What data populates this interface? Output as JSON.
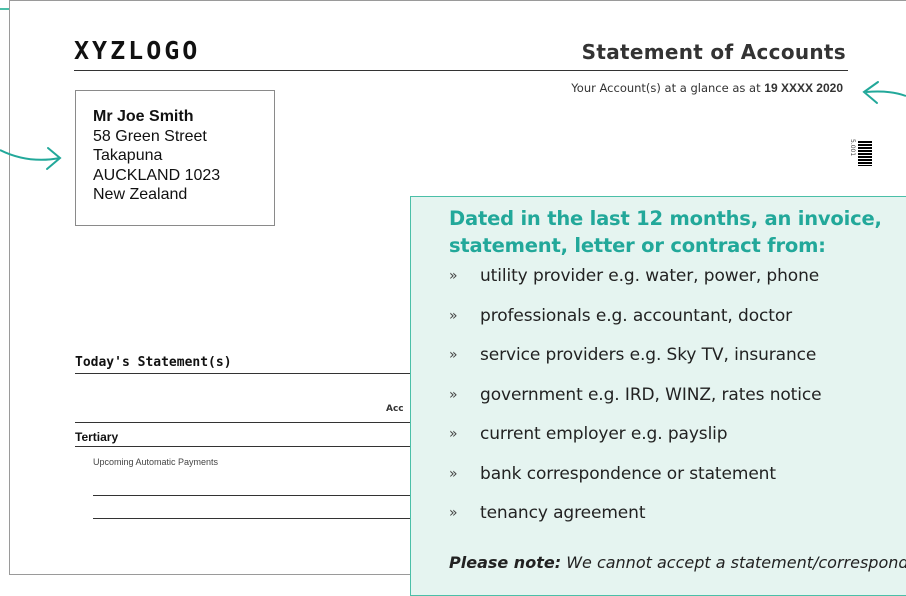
{
  "document": {
    "logo": "XYZLOGO",
    "title": "Statement of Accounts",
    "glance_prefix": "Your Account(s) at a glance as at",
    "glance_date": "19 XXXX 2020",
    "barcode_text": "5.001",
    "address": {
      "name": "Mr Joe Smith",
      "line1": "58 Green Street",
      "line2": "Takapuna",
      "line3": "AUCKLAND 1023",
      "line4": "New Zealand"
    },
    "today_statement": "Today's Statement(s)",
    "account_header": "Acc",
    "tertiary": "Tertiary",
    "upcoming": "Upcoming Automatic Payments"
  },
  "info": {
    "heading_line1": "Dated in the last 12 months, an invoice,",
    "heading_line2": "statement, letter or contract from:",
    "bullet_glyph": "»",
    "items": [
      "utility provider e.g. water, power, phone",
      "professionals e.g. accountant, doctor",
      "service providers e.g. Sky TV, insurance",
      "government e.g. IRD, WINZ, rates notice",
      "current employer e.g. payslip",
      "bank correspondence or statement",
      "tenancy agreement"
    ],
    "note_label": "Please note:",
    "note_text": "We cannot accept a statement/correspondence"
  },
  "colors": {
    "accent": "#22a89a",
    "callout_border": "#4bbfa8",
    "callout_bg": "#e5f4f0"
  }
}
